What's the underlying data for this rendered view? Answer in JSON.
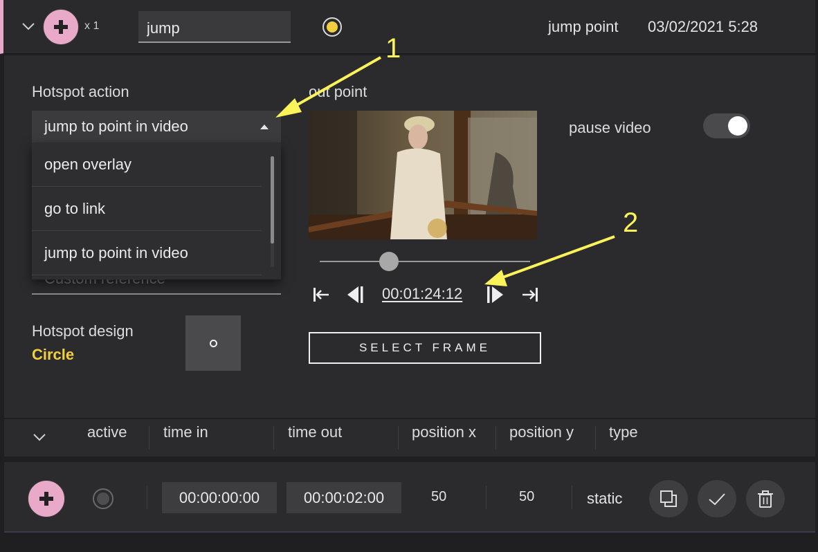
{
  "header": {
    "multiplier": "x 1",
    "name_value": "jump",
    "type_label": "jump point",
    "timestamp": "03/02/2021 5:28"
  },
  "hotspot_action": {
    "label": "Hotspot action",
    "selected": "jump to point in video",
    "options": [
      "open overlay",
      "go to link",
      "jump to point in video"
    ],
    "custom_reference_placeholder": "Custom reference"
  },
  "hotspot_design": {
    "label": "Hotspot design",
    "value": "Circle"
  },
  "out_point": {
    "label": "out point",
    "timecode": "00:01:24:12",
    "slider_fraction": 0.33,
    "select_frame_label": "SELECT FRAME"
  },
  "pause_video": {
    "label": "pause video",
    "on": true
  },
  "table": {
    "columns": [
      "active",
      "time in",
      "time out",
      "position x",
      "position y",
      "type"
    ],
    "rows": [
      {
        "time_in": "00:00:00:00",
        "time_out": "00:00:02:00",
        "position_x": "50",
        "position_y": "50",
        "type": "static"
      }
    ]
  },
  "annotations": [
    "1",
    "2"
  ],
  "colors": {
    "accent_yellow": "#f3cf3f",
    "accent_pink": "#e9aac9",
    "arrow_yellow": "#fbf35a"
  }
}
